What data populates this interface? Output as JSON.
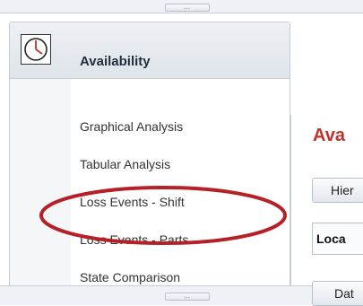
{
  "header": {
    "title": "Availability",
    "icon": "clock-icon"
  },
  "nav": {
    "items": [
      {
        "label": "Graphical Analysis"
      },
      {
        "label": "Tabular Analysis"
      },
      {
        "label": "Loss Events - Shift"
      },
      {
        "label": "Loss Events - Parts",
        "highlighted": true
      },
      {
        "label": "State Comparison"
      }
    ]
  },
  "grip_label": "…",
  "right_panel": {
    "title": "Ava",
    "tab_label": "Hier",
    "field_value": "Loca",
    "date_button_label": "Dat"
  },
  "colors": {
    "highlight_ellipse": "#b52127",
    "title_red": "#c0322a"
  }
}
